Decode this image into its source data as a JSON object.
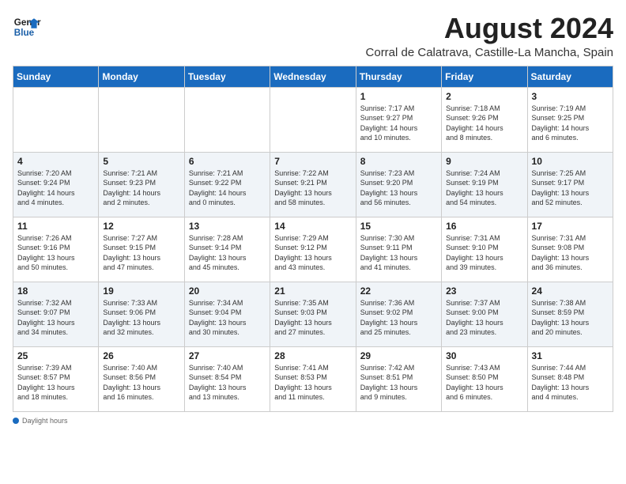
{
  "logo": {
    "line1": "General",
    "line2": "Blue"
  },
  "title": "August 2024",
  "subtitle": "Corral de Calatrava, Castille-La Mancha, Spain",
  "days_of_week": [
    "Sunday",
    "Monday",
    "Tuesday",
    "Wednesday",
    "Thursday",
    "Friday",
    "Saturday"
  ],
  "weeks": [
    [
      {
        "day": "",
        "info": ""
      },
      {
        "day": "",
        "info": ""
      },
      {
        "day": "",
        "info": ""
      },
      {
        "day": "",
        "info": ""
      },
      {
        "day": "1",
        "info": "Sunrise: 7:17 AM\nSunset: 9:27 PM\nDaylight: 14 hours\nand 10 minutes."
      },
      {
        "day": "2",
        "info": "Sunrise: 7:18 AM\nSunset: 9:26 PM\nDaylight: 14 hours\nand 8 minutes."
      },
      {
        "day": "3",
        "info": "Sunrise: 7:19 AM\nSunset: 9:25 PM\nDaylight: 14 hours\nand 6 minutes."
      }
    ],
    [
      {
        "day": "4",
        "info": "Sunrise: 7:20 AM\nSunset: 9:24 PM\nDaylight: 14 hours\nand 4 minutes."
      },
      {
        "day": "5",
        "info": "Sunrise: 7:21 AM\nSunset: 9:23 PM\nDaylight: 14 hours\nand 2 minutes."
      },
      {
        "day": "6",
        "info": "Sunrise: 7:21 AM\nSunset: 9:22 PM\nDaylight: 14 hours\nand 0 minutes."
      },
      {
        "day": "7",
        "info": "Sunrise: 7:22 AM\nSunset: 9:21 PM\nDaylight: 13 hours\nand 58 minutes."
      },
      {
        "day": "8",
        "info": "Sunrise: 7:23 AM\nSunset: 9:20 PM\nDaylight: 13 hours\nand 56 minutes."
      },
      {
        "day": "9",
        "info": "Sunrise: 7:24 AM\nSunset: 9:19 PM\nDaylight: 13 hours\nand 54 minutes."
      },
      {
        "day": "10",
        "info": "Sunrise: 7:25 AM\nSunset: 9:17 PM\nDaylight: 13 hours\nand 52 minutes."
      }
    ],
    [
      {
        "day": "11",
        "info": "Sunrise: 7:26 AM\nSunset: 9:16 PM\nDaylight: 13 hours\nand 50 minutes."
      },
      {
        "day": "12",
        "info": "Sunrise: 7:27 AM\nSunset: 9:15 PM\nDaylight: 13 hours\nand 47 minutes."
      },
      {
        "day": "13",
        "info": "Sunrise: 7:28 AM\nSunset: 9:14 PM\nDaylight: 13 hours\nand 45 minutes."
      },
      {
        "day": "14",
        "info": "Sunrise: 7:29 AM\nSunset: 9:12 PM\nDaylight: 13 hours\nand 43 minutes."
      },
      {
        "day": "15",
        "info": "Sunrise: 7:30 AM\nSunset: 9:11 PM\nDaylight: 13 hours\nand 41 minutes."
      },
      {
        "day": "16",
        "info": "Sunrise: 7:31 AM\nSunset: 9:10 PM\nDaylight: 13 hours\nand 39 minutes."
      },
      {
        "day": "17",
        "info": "Sunrise: 7:31 AM\nSunset: 9:08 PM\nDaylight: 13 hours\nand 36 minutes."
      }
    ],
    [
      {
        "day": "18",
        "info": "Sunrise: 7:32 AM\nSunset: 9:07 PM\nDaylight: 13 hours\nand 34 minutes."
      },
      {
        "day": "19",
        "info": "Sunrise: 7:33 AM\nSunset: 9:06 PM\nDaylight: 13 hours\nand 32 minutes."
      },
      {
        "day": "20",
        "info": "Sunrise: 7:34 AM\nSunset: 9:04 PM\nDaylight: 13 hours\nand 30 minutes."
      },
      {
        "day": "21",
        "info": "Sunrise: 7:35 AM\nSunset: 9:03 PM\nDaylight: 13 hours\nand 27 minutes."
      },
      {
        "day": "22",
        "info": "Sunrise: 7:36 AM\nSunset: 9:02 PM\nDaylight: 13 hours\nand 25 minutes."
      },
      {
        "day": "23",
        "info": "Sunrise: 7:37 AM\nSunset: 9:00 PM\nDaylight: 13 hours\nand 23 minutes."
      },
      {
        "day": "24",
        "info": "Sunrise: 7:38 AM\nSunset: 8:59 PM\nDaylight: 13 hours\nand 20 minutes."
      }
    ],
    [
      {
        "day": "25",
        "info": "Sunrise: 7:39 AM\nSunset: 8:57 PM\nDaylight: 13 hours\nand 18 minutes."
      },
      {
        "day": "26",
        "info": "Sunrise: 7:40 AM\nSunset: 8:56 PM\nDaylight: 13 hours\nand 16 minutes."
      },
      {
        "day": "27",
        "info": "Sunrise: 7:40 AM\nSunset: 8:54 PM\nDaylight: 13 hours\nand 13 minutes."
      },
      {
        "day": "28",
        "info": "Sunrise: 7:41 AM\nSunset: 8:53 PM\nDaylight: 13 hours\nand 11 minutes."
      },
      {
        "day": "29",
        "info": "Sunrise: 7:42 AM\nSunset: 8:51 PM\nDaylight: 13 hours\nand 9 minutes."
      },
      {
        "day": "30",
        "info": "Sunrise: 7:43 AM\nSunset: 8:50 PM\nDaylight: 13 hours\nand 6 minutes."
      },
      {
        "day": "31",
        "info": "Sunrise: 7:44 AM\nSunset: 8:48 PM\nDaylight: 13 hours\nand 4 minutes."
      }
    ]
  ],
  "footer": {
    "note": "Daylight hours"
  }
}
